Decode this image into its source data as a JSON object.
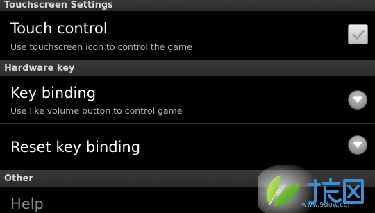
{
  "sections": {
    "touchscreen": "Touchscreen Settings",
    "hardware": "Hardware key",
    "other": "Other"
  },
  "items": {
    "touch_control": {
      "title": "Touch control",
      "summary": "Use touchscreen icon to control the game",
      "checked": true
    },
    "key_binding": {
      "title": "Key binding",
      "summary": "Use like volume button to control game"
    },
    "reset_key_binding": {
      "title": "Reset key binding"
    },
    "help": {
      "title": "Help"
    }
  },
  "watermark": {
    "logo_text": "九度网",
    "url": "www.9duw.com"
  },
  "icons": {
    "checkbox": "check-icon",
    "dropdown": "dropdown-arrow-icon"
  }
}
